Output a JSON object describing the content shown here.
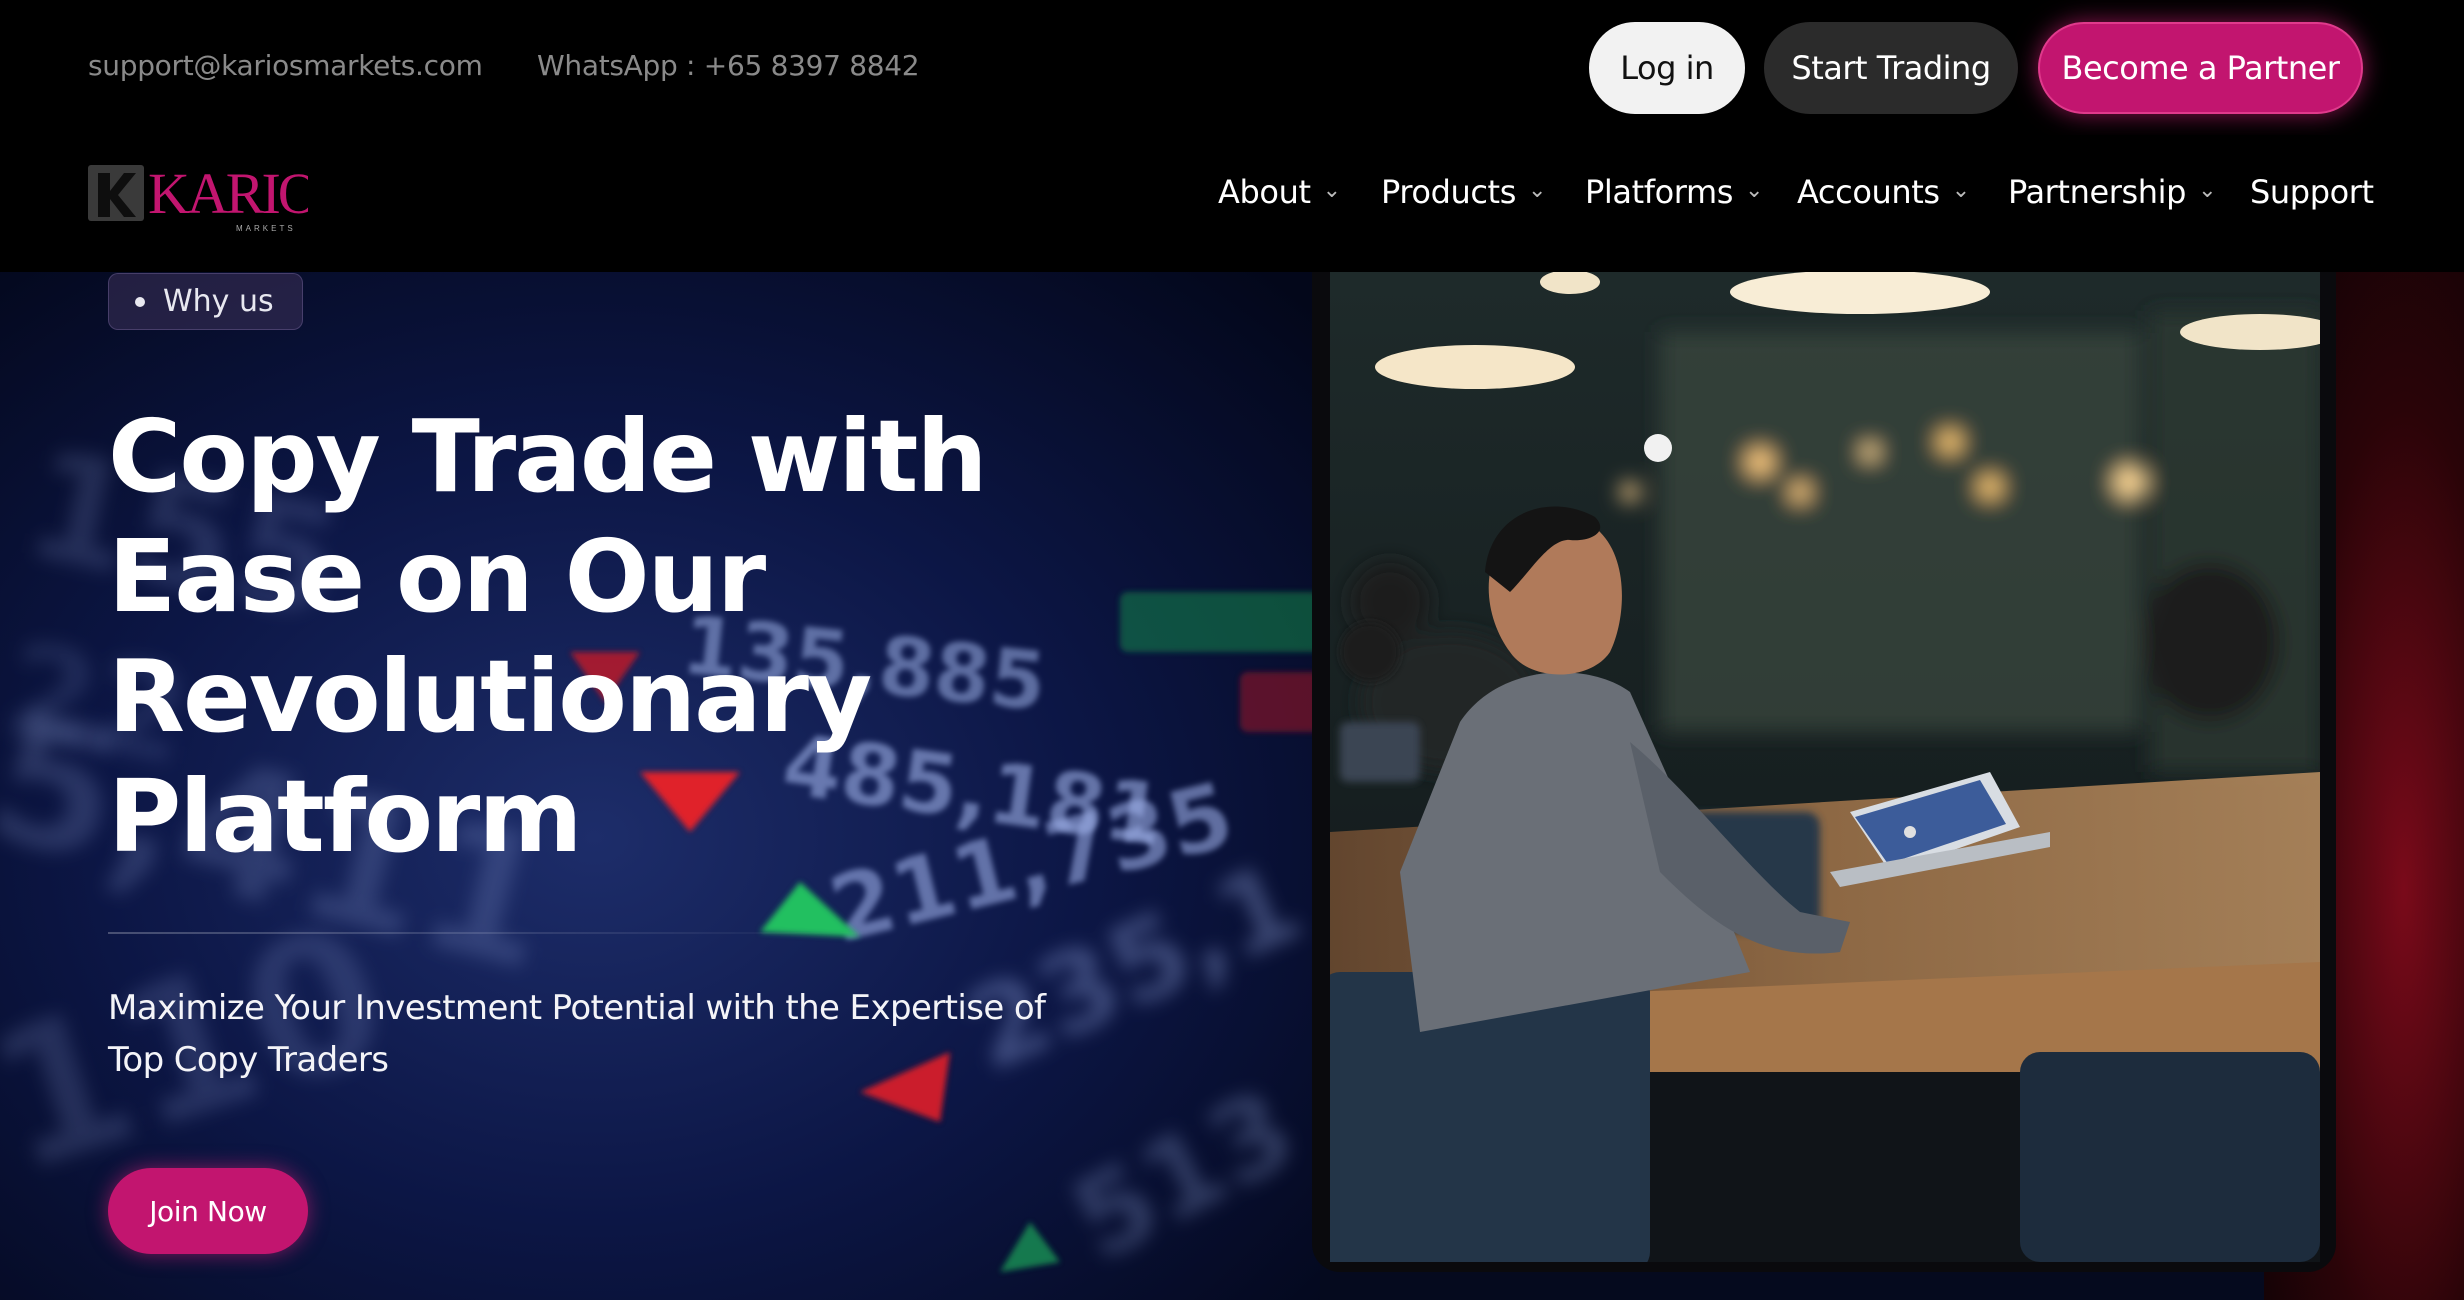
{
  "topbar": {
    "email": "support@kariosmarkets.com",
    "whatsapp": "WhatsApp : +65 8397 8842",
    "login_label": "Log in",
    "start_trading_label": "Start Trading",
    "partner_label": "Become a Partner"
  },
  "brand": {
    "logo_text": "KARIOS",
    "logo_subtext": "MARKETS",
    "accent": "#c2156f"
  },
  "nav": {
    "items": [
      {
        "label": "About",
        "has_dropdown": true
      },
      {
        "label": "Products",
        "has_dropdown": true
      },
      {
        "label": "Platforms",
        "has_dropdown": true
      },
      {
        "label": "Accounts",
        "has_dropdown": true
      },
      {
        "label": "Partnership",
        "has_dropdown": true
      },
      {
        "label": "Support",
        "has_dropdown": false
      }
    ],
    "chevron": "⌄"
  },
  "hero": {
    "tag": "Why us",
    "headline": "Copy Trade with Ease on Our Revolutionary Platform",
    "subheadline": "Maximize Your Investment Potential with the Expertise of Top Copy Traders",
    "cta": "Join Now",
    "ticker_numbers": [
      "135,885",
      "485,181",
      "211,735",
      "235,1",
      "513"
    ]
  },
  "icons": {
    "nav_dropdown": "chevron-down-icon",
    "tag_bullet": "bullet-icon"
  }
}
